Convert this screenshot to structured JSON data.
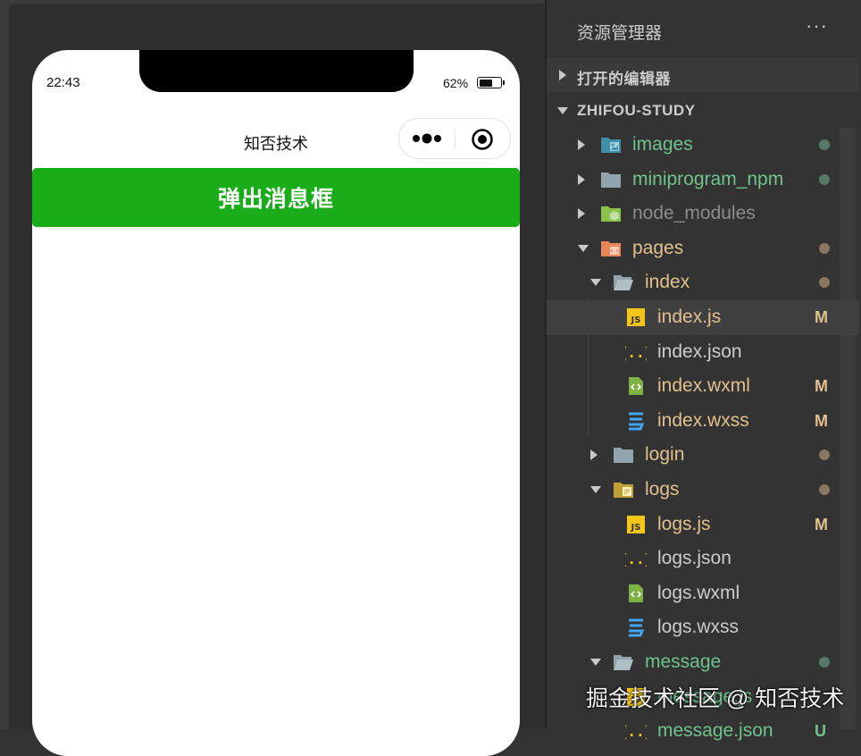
{
  "phone": {
    "time": "22:43",
    "battery_percent": "62%",
    "battery_level": 0.62,
    "nav_title": "知否技术",
    "button_label": "弹出消息框"
  },
  "explorer": {
    "title": "资源管理器",
    "more": "···",
    "open_editors": "打开的编辑器",
    "project": "ZHIFOU-STUDY",
    "items": [
      {
        "name": "images",
        "depth": 1,
        "twisty": "right",
        "icon": "images-folder-icon",
        "color": "#6fc38b",
        "mark": "dot",
        "mark_color": "#577a66"
      },
      {
        "name": "miniprogram_npm",
        "depth": 1,
        "twisty": "right",
        "icon": "folder-icon",
        "color": "#6fc38b",
        "mark": "dot",
        "mark_color": "#577a66"
      },
      {
        "name": "node_modules",
        "depth": 1,
        "twisty": "right",
        "icon": "node-folder-icon",
        "color": "#8c8c8c",
        "mark": "",
        "mark_color": ""
      },
      {
        "name": "pages",
        "depth": 1,
        "twisty": "down",
        "icon": "pages-folder-icon",
        "color": "#e2c08d",
        "mark": "dot",
        "mark_color": "#8a7561"
      },
      {
        "name": "index",
        "depth": 2,
        "twisty": "down",
        "icon": "folder-open-icon",
        "color": "#e2c08d",
        "mark": "dot",
        "mark_color": "#8a7561"
      },
      {
        "name": "index.js",
        "depth": 3,
        "twisty": "",
        "icon": "js-file-icon",
        "color": "#e2c08d",
        "mark": "M",
        "mark_color": "#e2c08d",
        "selected": true
      },
      {
        "name": "index.json",
        "depth": 3,
        "twisty": "",
        "icon": "json-file-icon",
        "color": "#cccccc",
        "mark": "",
        "mark_color": ""
      },
      {
        "name": "index.wxml",
        "depth": 3,
        "twisty": "",
        "icon": "wxml-file-icon",
        "color": "#e2c08d",
        "mark": "M",
        "mark_color": "#e2c08d"
      },
      {
        "name": "index.wxss",
        "depth": 3,
        "twisty": "",
        "icon": "wxss-file-icon",
        "color": "#e2c08d",
        "mark": "M",
        "mark_color": "#e2c08d"
      },
      {
        "name": "login",
        "depth": 2,
        "twisty": "right",
        "icon": "folder-icon",
        "color": "#e2c08d",
        "mark": "dot",
        "mark_color": "#8a7561"
      },
      {
        "name": "logs",
        "depth": 2,
        "twisty": "down",
        "icon": "logs-folder-icon",
        "color": "#e2c08d",
        "mark": "dot",
        "mark_color": "#8a7561"
      },
      {
        "name": "logs.js",
        "depth": 3,
        "twisty": "",
        "icon": "js-file-icon",
        "color": "#e2c08d",
        "mark": "M",
        "mark_color": "#e2c08d"
      },
      {
        "name": "logs.json",
        "depth": 3,
        "twisty": "",
        "icon": "json-file-icon",
        "color": "#cccccc",
        "mark": "",
        "mark_color": ""
      },
      {
        "name": "logs.wxml",
        "depth": 3,
        "twisty": "",
        "icon": "wxml-file-icon",
        "color": "#cccccc",
        "mark": "",
        "mark_color": ""
      },
      {
        "name": "logs.wxss",
        "depth": 3,
        "twisty": "",
        "icon": "wxss-file-icon",
        "color": "#cccccc",
        "mark": "",
        "mark_color": ""
      },
      {
        "name": "message",
        "depth": 2,
        "twisty": "down",
        "icon": "folder-open-icon",
        "color": "#6fc38b",
        "mark": "dot",
        "mark_color": "#577a66"
      },
      {
        "name": "message.js",
        "depth": 3,
        "twisty": "",
        "icon": "js-file-icon",
        "color": "#6fc38b",
        "mark": "",
        "mark_color": ""
      },
      {
        "name": "message.json",
        "depth": 3,
        "twisty": "",
        "icon": "json-file-icon",
        "color": "#6fc38b",
        "mark": "U",
        "mark_color": "#6fc38b"
      }
    ]
  },
  "watermark": "掘金技术社区 @ 知否技术",
  "colors": {
    "primary_button": "#1aad19",
    "modified": "#e2c08d",
    "untracked": "#6fc38b"
  }
}
